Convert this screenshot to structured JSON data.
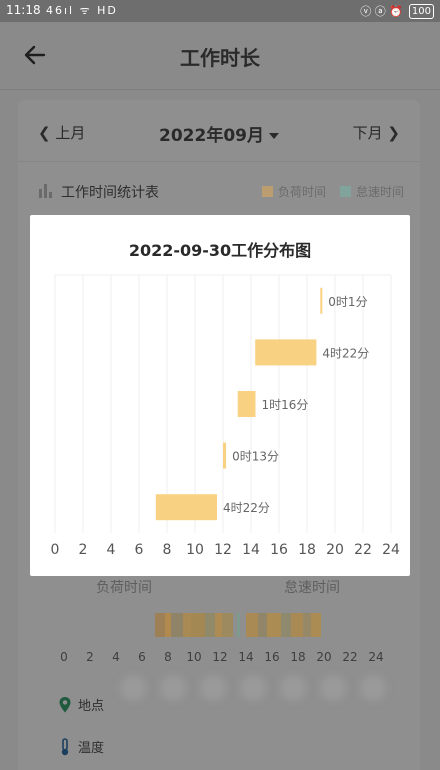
{
  "status_bar": {
    "time": "11:18",
    "signal_text": "46ıl ᯤ HD",
    "right_icons": "ⓥ ⓐ ⏰",
    "battery": "100"
  },
  "header": {
    "title": "工作时长"
  },
  "month_nav": {
    "prev": "上月",
    "current": "2022年09月",
    "next": "下月"
  },
  "stats": {
    "title": "工作时间统计表",
    "legend": [
      {
        "label": "负荷时间",
        "color": "#e1a958"
      },
      {
        "label": "怠速时间",
        "color": "#74b6a8"
      }
    ]
  },
  "lower": {
    "load_label": "负荷时间",
    "speed_label": "怠速时间",
    "axis_ticks": [
      "0",
      "2",
      "4",
      "6",
      "8",
      "10",
      "12",
      "14",
      "16",
      "18",
      "20",
      "22",
      "24"
    ],
    "location_label": "地点",
    "temperature_label": "温度"
  },
  "dialog": {
    "title": "2022-09-30工作分布图"
  },
  "chart_data": {
    "type": "bar",
    "orientation": "horizontal-range",
    "xlim": [
      0,
      24
    ],
    "x_ticks": [
      0,
      2,
      4,
      6,
      8,
      10,
      12,
      14,
      16,
      18,
      20,
      22,
      24
    ],
    "bar_color": "#f8d282",
    "grid": true,
    "bars": [
      {
        "start": 18.95,
        "end": 18.97,
        "label": "0时1分"
      },
      {
        "start": 14.3,
        "end": 18.67,
        "label": "4时22分"
      },
      {
        "start": 13.05,
        "end": 14.32,
        "label": "1时16分"
      },
      {
        "start": 12.0,
        "end": 12.22,
        "label": "0时13分"
      },
      {
        "start": 7.2,
        "end": 11.57,
        "label": "4时22分"
      }
    ]
  }
}
